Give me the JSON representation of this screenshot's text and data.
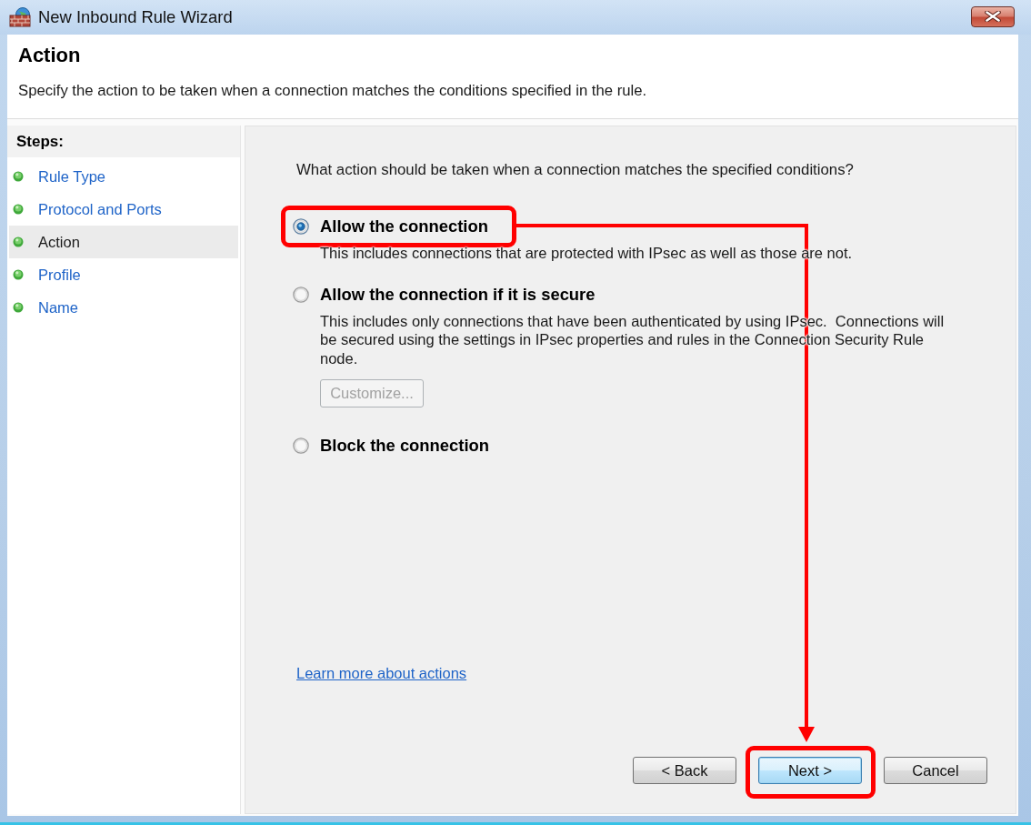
{
  "window": {
    "title": "New Inbound Rule Wizard"
  },
  "header": {
    "title": "Action",
    "description": "Specify the action to be taken when a connection matches the conditions specified in the rule."
  },
  "steps": {
    "heading": "Steps:",
    "items": [
      {
        "label": "Rule Type",
        "selected": false
      },
      {
        "label": "Protocol and Ports",
        "selected": false
      },
      {
        "label": "Action",
        "selected": true
      },
      {
        "label": "Profile",
        "selected": false
      },
      {
        "label": "Name",
        "selected": false
      }
    ]
  },
  "page": {
    "question": "What action should be taken when a connection matches the specified conditions?",
    "options": [
      {
        "label": "Allow the connection",
        "description": "This includes connections that are protected with IPsec as well as those are not.",
        "selected": true,
        "highlighted": true
      },
      {
        "label": "Allow the connection if it is secure",
        "description": "This includes only connections that have been authenticated by using IPsec.  Connections will be secured using the settings in IPsec properties and rules in the Connection Security Rule node.",
        "selected": false,
        "highlighted": false,
        "button": {
          "label": "Customize...",
          "disabled": true
        }
      },
      {
        "label": "Block the connection",
        "selected": false,
        "highlighted": false
      }
    ],
    "link": "Learn more about actions"
  },
  "buttons": [
    {
      "label": "< Back",
      "default": false,
      "highlighted": false
    },
    {
      "label": "Next >",
      "default": true,
      "highlighted": true
    },
    {
      "label": "Cancel",
      "default": false,
      "highlighted": false
    }
  ]
}
